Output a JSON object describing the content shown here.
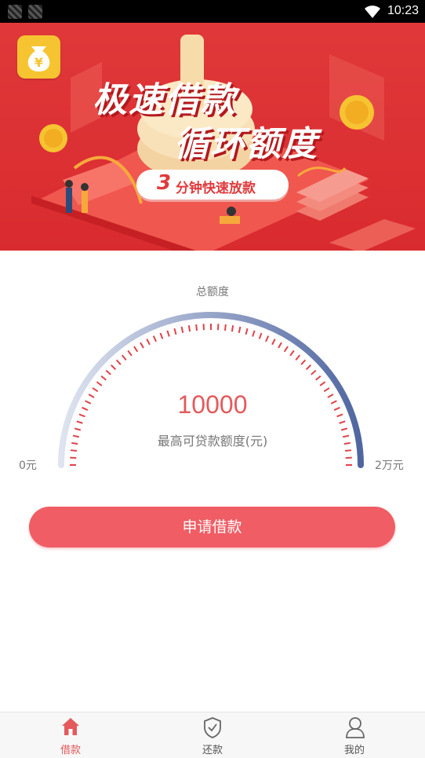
{
  "status_bar": {
    "time": "10:23"
  },
  "banner": {
    "title_line1": "极速借款",
    "title_line2": "循环额度",
    "promo_number": "3",
    "promo_text": "分钟快速放款"
  },
  "gauge": {
    "title": "总额度",
    "amount": "10000",
    "amount_label": "最高可贷款额度(元)",
    "min_label": "0元",
    "max_label": "2万元",
    "level_fraction": 0.5
  },
  "apply_button": {
    "label": "申请借款"
  },
  "tabs": [
    {
      "label": "借款",
      "icon": "home-icon",
      "active": true
    },
    {
      "label": "还款",
      "icon": "shield-check-icon",
      "active": false
    },
    {
      "label": "我的",
      "icon": "user-icon",
      "active": false
    }
  ],
  "colors": {
    "accent": "#f05d64",
    "banner_red": "#d92b2f",
    "gauge_gradient_start": "#dfe4f0",
    "gauge_gradient_end": "#4f66a0",
    "tick_red": "#e0424a",
    "tab_active": "#e45a5c",
    "tab_inactive": "#555555"
  }
}
